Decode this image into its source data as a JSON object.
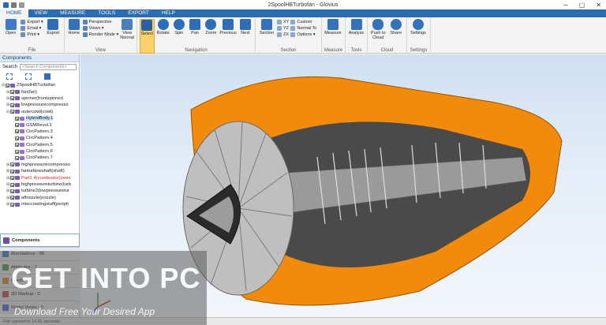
{
  "window": {
    "title": "2SpoolHBTurbofan - Glovius",
    "controls": [
      "─",
      "▢",
      "✕"
    ]
  },
  "tabs": [
    "HOME",
    "VIEW",
    "MEASURE",
    "TOOLS",
    "EXPORT",
    "HELP"
  ],
  "ribbon": {
    "file": {
      "label": "File",
      "open": "Open",
      "export_menu": "Export ▾",
      "email": "Email ▾",
      "print": "Print ▾",
      "export": "Export"
    },
    "view": {
      "label": "View",
      "home": "Home",
      "perspective": "Perspective",
      "views": "Views ▾",
      "render_mode": "Render Mode ▾",
      "view_normal": "View Normal"
    },
    "navigation": {
      "label": "Navigation",
      "select": "Select",
      "rotate": "Rotate",
      "spin": "Spin",
      "pan": "Pan",
      "zoom": "Zoom",
      "previous": "Previous",
      "next": "Next"
    },
    "section": {
      "label": "Section",
      "section": "Section",
      "xy": "XY",
      "yz": "YZ",
      "zx": "ZX",
      "custom": "Custom",
      "normal_to": "Normal To",
      "options": "Options ▾"
    },
    "measure": {
      "label": "Measure",
      "measure": "Measure"
    },
    "tools": {
      "label": "Tools",
      "analyze": "Analyze"
    },
    "cloud": {
      "label": "Cloud",
      "push": "Push to Cloud",
      "share": "Share"
    },
    "settings": {
      "label": "Settings",
      "settings": "Settings"
    }
  },
  "panel": {
    "title": "Components",
    "search_label": "Search",
    "search_placeholder": "<Search Components>",
    "tree": [
      {
        "label": "2SpoolHBTurbofan",
        "indent": 0,
        "toggle": "⊟",
        "kind": "asm"
      },
      {
        "label": "fan(fan)",
        "indent": 1,
        "toggle": "⊞",
        "kind": "asm"
      },
      {
        "label": "spinner(frontspinner)",
        "indent": 1,
        "toggle": "⊞",
        "kind": "asm"
      },
      {
        "label": "lowpressurecompresso",
        "indent": 1,
        "toggle": "⊞",
        "kind": "asm"
      },
      {
        "label": "outercowl(cowl)",
        "indent": 1,
        "toggle": "⊟",
        "kind": "asm"
      },
      {
        "label": "HybridBody.1",
        "indent": 2,
        "toggle": "",
        "kind": "part",
        "highlight": true
      },
      {
        "label": "GSMRevol.1",
        "indent": 2,
        "toggle": "",
        "kind": "part"
      },
      {
        "label": "CircPattern.3",
        "indent": 2,
        "toggle": "",
        "kind": "part"
      },
      {
        "label": "CircPattern.4",
        "indent": 2,
        "toggle": "",
        "kind": "part"
      },
      {
        "label": "CircPattern.5",
        "indent": 2,
        "toggle": "",
        "kind": "part"
      },
      {
        "label": "CircPattern.6",
        "indent": 2,
        "toggle": "",
        "kind": "part"
      },
      {
        "label": "CircPattern.7",
        "indent": 2,
        "toggle": "",
        "kind": "part"
      },
      {
        "label": "highpressurecompresso",
        "indent": 1,
        "toggle": "⊞",
        "kind": "asm"
      },
      {
        "label": "fanturbineshaft(shaft)",
        "indent": 1,
        "toggle": "⊞",
        "kind": "asm"
      },
      {
        "label": "Part1.4(combustor)(anni",
        "indent": 1,
        "toggle": "⊞",
        "kind": "asm",
        "red": true
      },
      {
        "label": "highpressureturbine(turb",
        "indent": 1,
        "toggle": "⊞",
        "kind": "asm"
      },
      {
        "label": "turbine2(lowpressuretur",
        "indent": 1,
        "toggle": "⊞",
        "kind": "asm"
      },
      {
        "label": "aftnozzle(nozzle)",
        "indent": 1,
        "toggle": "⊞",
        "kind": "asm"
      },
      {
        "label": "misccowlingstuff(periph",
        "indent": 1,
        "toggle": "⊞",
        "kind": "asm"
      }
    ],
    "sections": [
      {
        "label": "Components",
        "active": true,
        "color": "#6a4fb0"
      },
      {
        "label": "Annotations - 85",
        "active": false,
        "color": "#3c7fc4"
      },
      {
        "label": "Attributes - 7",
        "active": false,
        "color": "#4a9a4a"
      },
      {
        "label": "Feeds",
        "active": false,
        "color": "#c98a2a"
      },
      {
        "label": "3D Markup - 0",
        "active": false,
        "color": "#c44a4a"
      },
      {
        "label": "Model Views - 0",
        "active": false,
        "color": "#4a6ac4"
      }
    ]
  },
  "status": "File opened in 14.81 seconds",
  "watermark": {
    "title": "GET INTO PC",
    "subtitle": "Download Free Your Desired App"
  },
  "colors": {
    "ribbon_blue": "#2b6cb0",
    "engine_orange": "#f28a0c",
    "select_highlight": "#f8d36c"
  }
}
